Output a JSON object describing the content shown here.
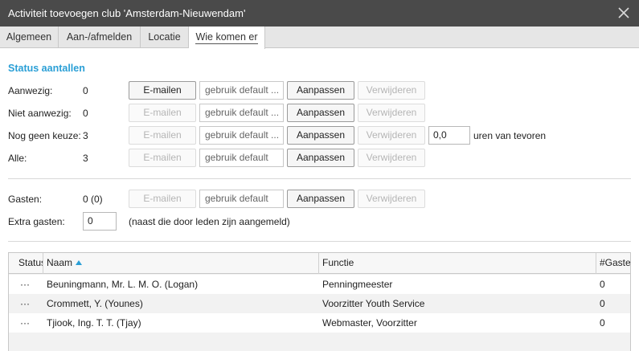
{
  "window": {
    "title": "Activiteit toevoegen club 'Amsterdam-Nieuwendam'"
  },
  "tabs": [
    {
      "label": "Algemeen"
    },
    {
      "label": "Aan-/afmelden"
    },
    {
      "label": "Locatie"
    },
    {
      "label": "Wie komen er",
      "active": true
    }
  ],
  "status": {
    "section_title": "Status aantallen",
    "rows": [
      {
        "label": "Aanwezig:",
        "count": "0",
        "email_label": "E-mailen",
        "email_enabled": true,
        "select_value": "gebruik default ...",
        "adjust_label": "Aanpassen",
        "remove_label": "Verwijderen"
      },
      {
        "label": "Niet aanwezig:",
        "count": "0",
        "email_label": "E-mailen",
        "email_enabled": false,
        "select_value": "gebruik default ...",
        "adjust_label": "Aanpassen",
        "remove_label": "Verwijderen"
      },
      {
        "label": "Nog geen keuze:",
        "count": "3",
        "email_label": "E-mailen",
        "email_enabled": false,
        "select_value": "gebruik default ...",
        "adjust_label": "Aanpassen",
        "remove_label": "Verwijderen",
        "hours_value": "0,0",
        "hours_suffix": "uren van tevoren"
      },
      {
        "label": "Alle:",
        "count": "3",
        "email_label": "E-mailen",
        "email_enabled": false,
        "select_value": "gebruik default",
        "adjust_label": "Aanpassen",
        "remove_label": "Verwijderen"
      }
    ]
  },
  "guests": {
    "label": "Gasten:",
    "count": "0 (0)",
    "email_label": "E-mailen",
    "select_value": "gebruik default",
    "adjust_label": "Aanpassen",
    "remove_label": "Verwijderen",
    "extra_label": "Extra gasten:",
    "extra_value": "0",
    "extra_note": "(naast die door leden zijn aangemeld)"
  },
  "table": {
    "columns": [
      "Status",
      "Naam",
      "Functie",
      "#Gasten"
    ],
    "sort_column": "Naam",
    "rows": [
      {
        "status": "···",
        "naam": "Beuningmann, Mr. L. M. O. (Logan)",
        "functie": "Penningmeester",
        "gasten": "0"
      },
      {
        "status": "···",
        "naam": "Crommett, Y. (Younes)",
        "functie": "Voorzitter Youth Service",
        "gasten": "0"
      },
      {
        "status": "···",
        "naam": "Tjiook, Ing. T. T. (Tjay)",
        "functie": "Webmaster, Voorzitter",
        "gasten": "0"
      }
    ]
  },
  "colors": {
    "titlebar": "#4a4a4a",
    "accent": "#2a9fd6"
  }
}
